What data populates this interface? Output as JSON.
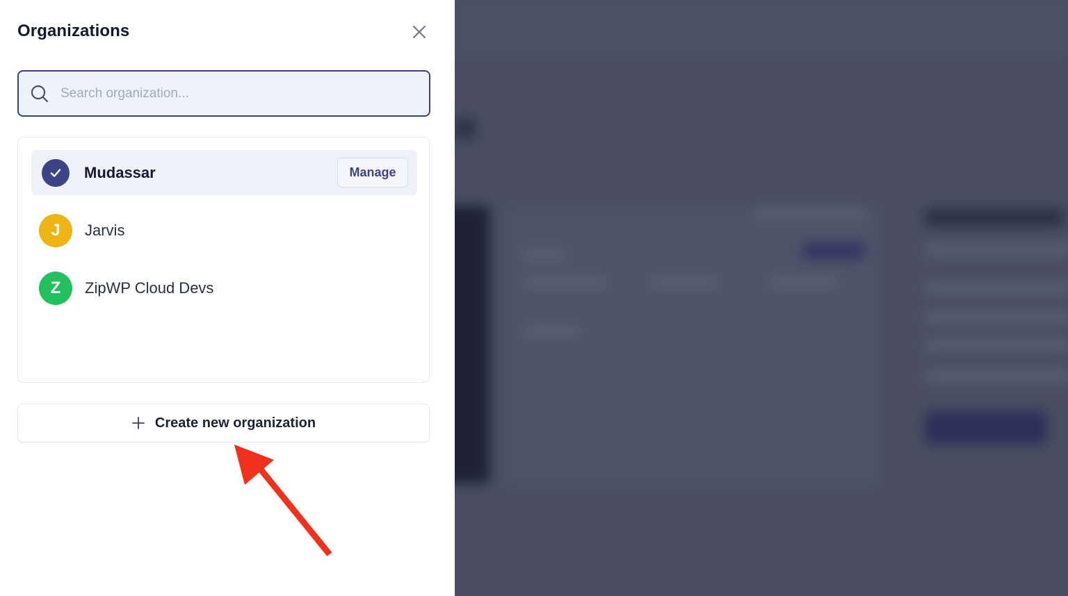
{
  "panel": {
    "title": "Organizations",
    "close_icon": "close-icon"
  },
  "search": {
    "placeholder": "Search organization...",
    "value": "",
    "icon": "search-icon"
  },
  "organizations": [
    {
      "name": "Mudassar",
      "selected": true,
      "avatar_icon": "checkmark-icon",
      "avatar_color": "#3d4387",
      "action_label": "Manage"
    },
    {
      "name": "Jarvis",
      "selected": false,
      "avatar_letter": "J",
      "avatar_color": "#ecb414"
    },
    {
      "name": "ZipWP Cloud Devs",
      "selected": false,
      "avatar_letter": "Z",
      "avatar_color": "#22c15e"
    }
  ],
  "create_button": {
    "label": "Create new organization",
    "icon": "plus-icon"
  },
  "annotation": {
    "type": "arrow",
    "color": "#f0321c",
    "points_to": "create-new-organization-button"
  },
  "colors": {
    "accent": "#3d4387",
    "backdrop": "#4a4e60",
    "title": "#141a2e"
  }
}
